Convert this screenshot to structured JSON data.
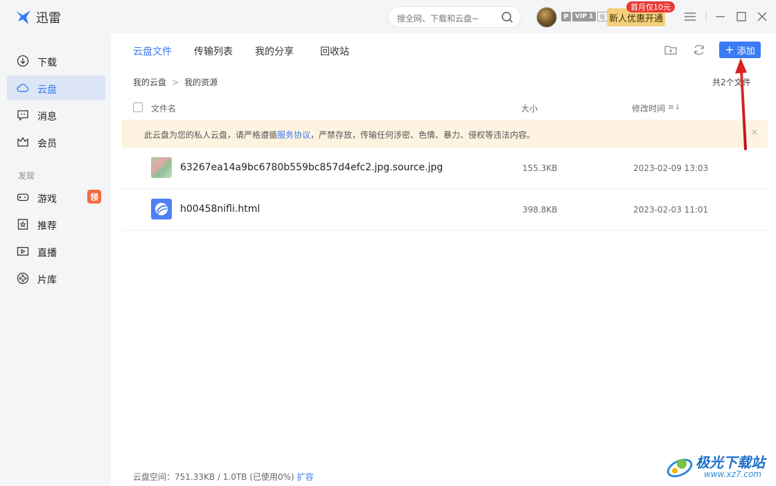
{
  "app": {
    "name": "迅雷"
  },
  "search": {
    "placeholder": "搜全网、下载和云盘~"
  },
  "account": {
    "vip_p": "P",
    "vip_level": "VIP 1",
    "vip_year": "年",
    "promo_badge": "首月仅10元",
    "promo_button": "新人优惠开通"
  },
  "sidebar": {
    "items": [
      {
        "label": "下载",
        "icon": "download-icon"
      },
      {
        "label": "云盘",
        "icon": "cloud-icon"
      },
      {
        "label": "消息",
        "icon": "message-icon"
      },
      {
        "label": "会员",
        "icon": "crown-icon"
      }
    ],
    "section_label": "发现",
    "discover": [
      {
        "label": "游戏",
        "icon": "gamepad-icon",
        "badge": "领"
      },
      {
        "label": "推荐",
        "icon": "star-bookmark-icon"
      },
      {
        "label": "直播",
        "icon": "live-icon"
      },
      {
        "label": "片库",
        "icon": "film-reel-icon"
      }
    ]
  },
  "tabs": [
    {
      "label": "云盘文件"
    },
    {
      "label": "传输列表"
    },
    {
      "label": "我的分享"
    },
    {
      "label": "回收站"
    }
  ],
  "toolbar": {
    "add_label": "添加"
  },
  "breadcrumb": {
    "root": "我的云盘",
    "current": "我的资源"
  },
  "file_count": "共2个文件",
  "columns": {
    "name": "文件名",
    "size": "大小",
    "modified": "修改时间"
  },
  "notice": {
    "before": "此云盘为您的私人云盘，请严格遵循",
    "link": "服务协议",
    "after": "，严禁存放，传输任何涉密、色情、暴力、侵权等违法内容。",
    "close": "×"
  },
  "files": [
    {
      "name": "63267ea14a9bc6780b559bc857d4efc2.jpg.source.jpg",
      "size": "155.3KB",
      "date": "2023-02-09 13:03",
      "type": "image"
    },
    {
      "name": "h00458nifli.html",
      "size": "398.8KB",
      "date": "2023-02-03 11:01",
      "type": "html"
    }
  ],
  "footer": {
    "text": "云盘空间：751.33KB / 1.0TB (已使用0%)",
    "link": "扩容"
  },
  "watermark": {
    "title": "极光下载站",
    "url": "www.xz7.com"
  },
  "colors": {
    "accent": "#3b7cf6",
    "sidebar_bg": "#f4f5f7",
    "notice_bg": "#fdf3e0",
    "arrow": "#d9201f"
  }
}
